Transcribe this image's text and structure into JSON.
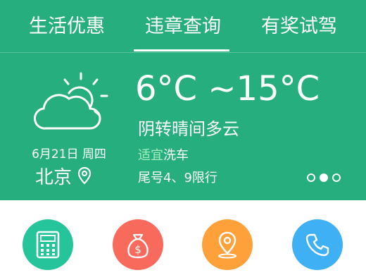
{
  "tabs": [
    {
      "label": "生活优惠"
    },
    {
      "label": "违章查询"
    },
    {
      "label": "有奖试驾"
    }
  ],
  "active_tab_index": 1,
  "weather": {
    "icon": "partly-cloudy-icon",
    "date": "6月21日 周四",
    "city": "北京",
    "temperature_range": "6°C ~15°C",
    "condition": "阴转晴间多云",
    "car_wash_prefix": "适宜",
    "car_wash_suffix": "洗车",
    "restriction": "尾号4、9限行"
  },
  "pager": {
    "count": 3,
    "active_index": 1
  },
  "quick_actions": [
    {
      "icon": "calculator-icon",
      "color": "#26c49a"
    },
    {
      "icon": "money-bag-icon",
      "color": "#f76a5c"
    },
    {
      "icon": "map-pin-icon",
      "color": "#ffa13a"
    },
    {
      "icon": "phone-icon",
      "color": "#3fb0f3"
    }
  ],
  "colors": {
    "header_bg": "#26ae7e",
    "highlight_text": "#a6f0bf"
  }
}
